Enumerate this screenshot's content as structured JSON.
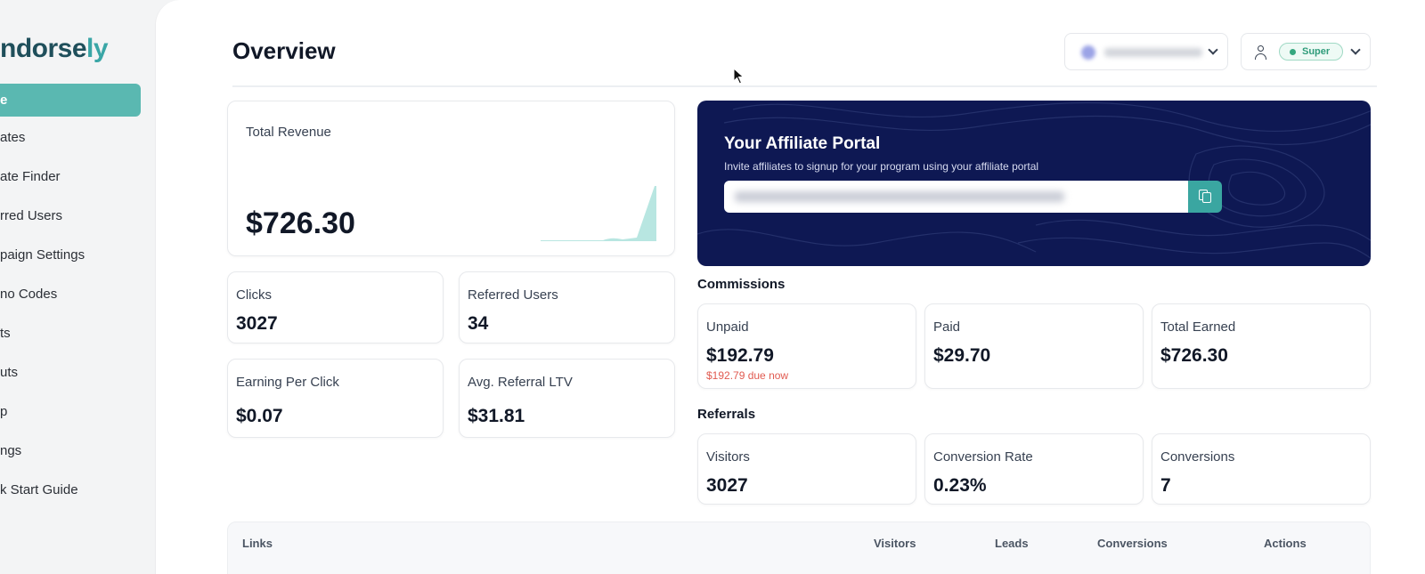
{
  "brand": {
    "part1": "ndorse",
    "part2": "ly"
  },
  "sidebar": {
    "active_label": "e",
    "items": [
      {
        "label": "ates"
      },
      {
        "label": "ate Finder"
      },
      {
        "label": "rred Users"
      },
      {
        "label": "paign Settings"
      },
      {
        "label": "no Codes"
      },
      {
        "label": "ts"
      },
      {
        "label": "uts"
      },
      {
        "label": "p"
      },
      {
        "label": "ngs"
      },
      {
        "label": "k Start Guide"
      }
    ]
  },
  "header": {
    "title": "Overview",
    "account_badge": "Super",
    "icons": {
      "account": "person-icon",
      "dropdown": "chevron-down-icon"
    }
  },
  "revenue": {
    "label": "Total Revenue",
    "value": "$726.30"
  },
  "stats": {
    "clicks": {
      "label": "Clicks",
      "value": "3027"
    },
    "referred_users": {
      "label": "Referred Users",
      "value": "34"
    },
    "epc": {
      "label": "Earning Per Click",
      "value": "$0.07"
    },
    "avg_ltv": {
      "label": "Avg. Referral LTV",
      "value": "$31.81"
    }
  },
  "portal": {
    "title": "Your Affiliate Portal",
    "subtitle": "Invite affiliates to signup for your program using your affiliate portal",
    "copy_icon": "copy-icon"
  },
  "commissions": {
    "title": "Commissions",
    "unpaid": {
      "label": "Unpaid",
      "value": "$192.79",
      "note": "$192.79 due now"
    },
    "paid": {
      "label": "Paid",
      "value": "$29.70"
    },
    "total_earned": {
      "label": "Total Earned",
      "value": "$726.30"
    }
  },
  "referrals": {
    "title": "Referrals",
    "visitors": {
      "label": "Visitors",
      "value": "3027"
    },
    "conversion_rate": {
      "label": "Conversion Rate",
      "value": "0.23%"
    },
    "conversions": {
      "label": "Conversions",
      "value": "7"
    }
  },
  "links_table": {
    "columns": [
      "Links",
      "Visitors",
      "Leads",
      "Conversions",
      "Actions"
    ]
  },
  "colors": {
    "accent": "#5ab8b1",
    "portal_bg": "#0e1853",
    "danger": "#e15a50",
    "brand_dark": "#1f4f5b",
    "brand_light": "#3aa6a6"
  }
}
